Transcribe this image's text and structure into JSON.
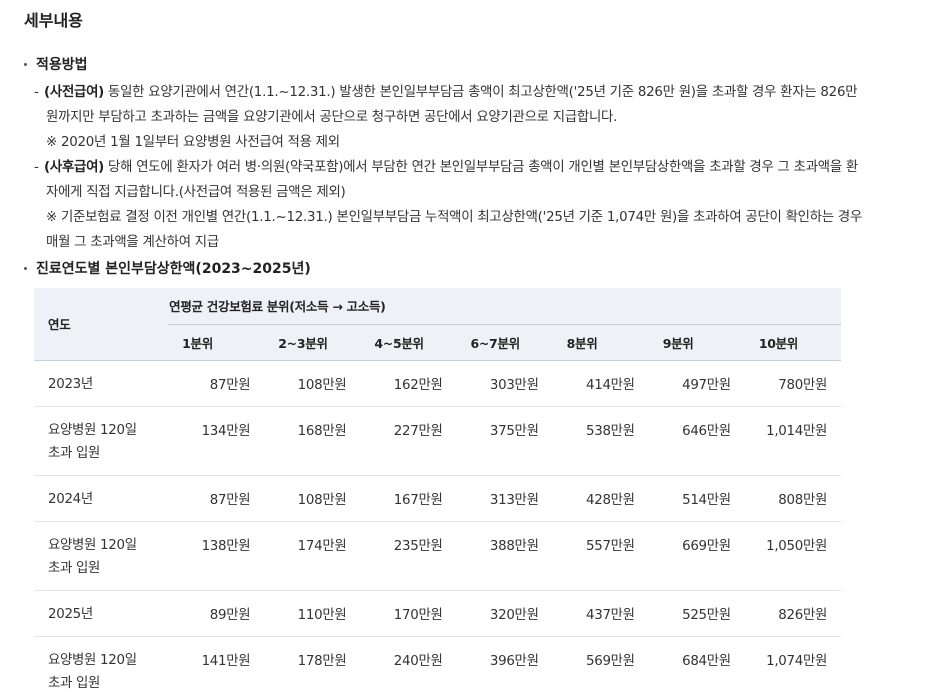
{
  "title": "세부내용",
  "section1": {
    "heading": "적용방법",
    "pre": {
      "tag": "(사전급여)",
      "line1": "동일한 요양기관에서 연간(1.1.~12.31.) 발생한 본인일부부담금 총액이 최고상한액('25년 기준 826만 원)을 초과할 경우 환자는 826만",
      "line2": "원까지만 부담하고 초과하는 금액을 요양기관에서 공단으로 청구하면 공단에서 요양기관으로 지급합니다.",
      "note": "※ 2020년 1월 1일부터 요양병원 사전급여 적용 제외"
    },
    "post": {
      "tag": "(사후급여)",
      "line1": "당해 연도에 환자가 여러 병·의원(약국포함)에서 부담한 연간 본인일부부담금 총액이 개인별 본인부담상한액을 초과할 경우 그 초과액을 환",
      "line2": "자에게 직접 지급합니다.(사전급여 적용된 금액은 제외)",
      "note1": "※ 기준보험료 결정 이전 개인별 연간(1.1.~12.31.) 본인일부부담금 누적액이 최고상한액('25년 기준 1,074만 원)을 초과하여 공단이 확인하는 경우",
      "note2": "매월 그 초과액을 계산하여 지급"
    }
  },
  "section2": {
    "heading": "진료연도별 본인부담상한액(2023~2025년)"
  },
  "table": {
    "year_header": "연도",
    "group_header": "연평균 건강보험료 분위(저소득 → 고소득)",
    "columns": [
      "1분위",
      "2~3분위",
      "4~5분위",
      "6~7분위",
      "8분위",
      "9분위",
      "10분위"
    ],
    "rows": [
      {
        "label1": "2023년",
        "label2": "",
        "values": [
          "87만원",
          "108만원",
          "162만원",
          "303만원",
          "414만원",
          "497만원",
          "780만원"
        ]
      },
      {
        "label1": "요양병원 120일",
        "label2": "초과 입원",
        "values": [
          "134만원",
          "168만원",
          "227만원",
          "375만원",
          "538만원",
          "646만원",
          "1,014만원"
        ]
      },
      {
        "label1": "2024년",
        "label2": "",
        "values": [
          "87만원",
          "108만원",
          "167만원",
          "313만원",
          "428만원",
          "514만원",
          "808만원"
        ]
      },
      {
        "label1": "요양병원 120일",
        "label2": "초과 입원",
        "values": [
          "138만원",
          "174만원",
          "235만원",
          "388만원",
          "557만원",
          "669만원",
          "1,050만원"
        ]
      },
      {
        "label1": "2025년",
        "label2": "",
        "values": [
          "89만원",
          "110만원",
          "170만원",
          "320만원",
          "437만원",
          "525만원",
          "826만원"
        ]
      },
      {
        "label1": "요양병원 120일",
        "label2": "초과 입원",
        "values": [
          "141만원",
          "178만원",
          "240만원",
          "396만원",
          "569만원",
          "684만원",
          "1,074만원"
        ]
      }
    ]
  }
}
